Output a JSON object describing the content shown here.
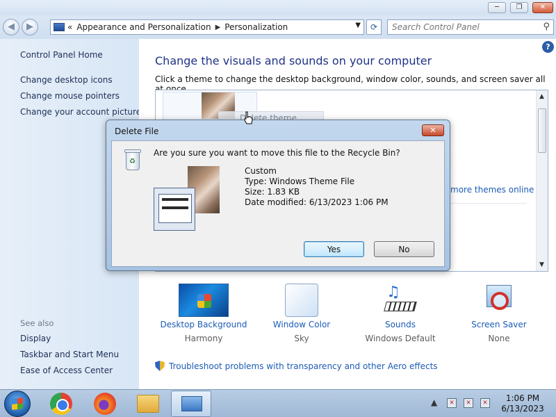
{
  "window": {
    "minimize": "─",
    "maximize": "❐",
    "close": "✕"
  },
  "address": {
    "back": "◀",
    "forward": "▶",
    "chevrons": "«",
    "crumbs": [
      "Appearance and Personalization",
      "Personalization"
    ],
    "search_placeholder": "Search Control Panel"
  },
  "sidebar": {
    "home": "Control Panel Home",
    "links": [
      "Change desktop icons",
      "Change mouse pointers",
      "Change your account picture"
    ],
    "see_also_heading": "See also",
    "see_also": [
      "Display",
      "Taskbar and Start Menu",
      "Ease of Access Center"
    ]
  },
  "main": {
    "help": "?",
    "title": "Change the visuals and sounds on your computer",
    "subtitle": "Click a theme to change the desktop background, window color, sounds, and screen saver all at once.",
    "drag_ghost": "Delete theme",
    "more_themes": "more themes online",
    "settings": [
      {
        "label": "Desktop Background",
        "value": "Harmony",
        "icon": "desktop-background-icon"
      },
      {
        "label": "Window Color",
        "value": "Sky",
        "icon": "window-color-icon"
      },
      {
        "label": "Sounds",
        "value": "Windows Default",
        "icon": "sounds-icon"
      },
      {
        "label": "Screen Saver",
        "value": "None",
        "icon": "screen-saver-icon"
      }
    ],
    "troubleshoot": "Troubleshoot problems with transparency and other Aero effects"
  },
  "dialog": {
    "title": "Delete File",
    "question": "Are you sure you want to move this file to the Recycle Bin?",
    "file_name": "Custom",
    "file_type": "Type: Windows Theme File",
    "file_size": "Size: 1.83 KB",
    "file_modified": "Date modified: 6/13/2023 1:06 PM",
    "yes": "Yes",
    "no": "No",
    "close": "✕"
  },
  "taskbar": {
    "time": "1:06 PM",
    "date": "6/13/2023",
    "tray_expand": "▲"
  },
  "colors": {
    "link": "#1c5bb5",
    "heading": "#1e3287",
    "window_frame": "#a6c2e2"
  }
}
